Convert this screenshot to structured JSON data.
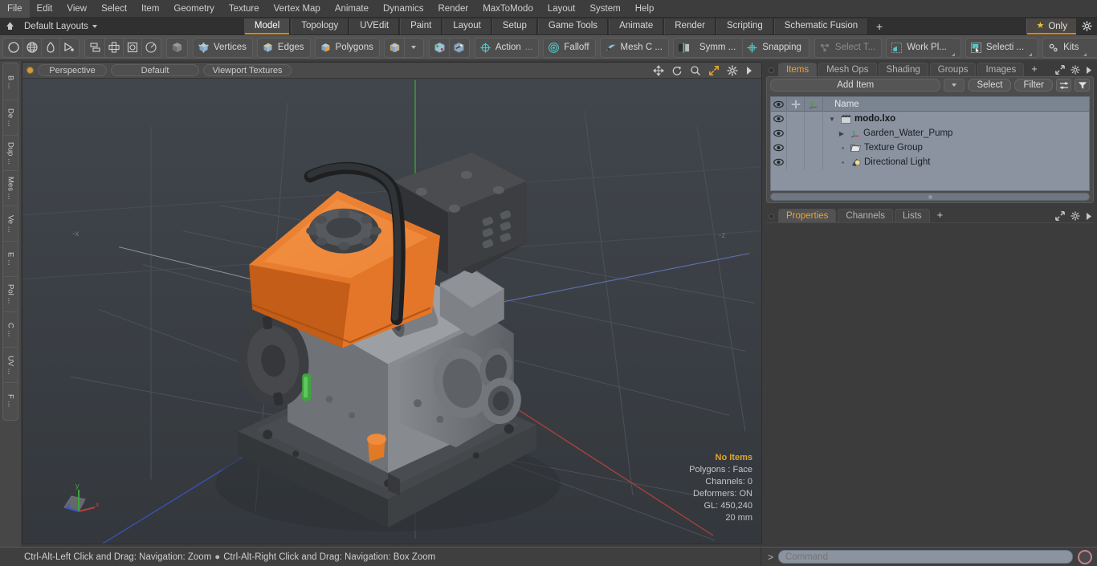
{
  "menu": {
    "items": [
      "File",
      "Edit",
      "View",
      "Select",
      "Item",
      "Geometry",
      "Texture",
      "Vertex Map",
      "Animate",
      "Dynamics",
      "Render",
      "MaxToModo",
      "Layout",
      "System",
      "Help"
    ]
  },
  "layoutbar": {
    "home_icon": "home-icon",
    "layouts_label": "Default Layouts",
    "tabs": [
      {
        "label": "Model",
        "active": true
      },
      {
        "label": "Topology",
        "active": false
      },
      {
        "label": "UVEdit",
        "active": false
      },
      {
        "label": "Paint",
        "active": false
      },
      {
        "label": "Layout",
        "active": false
      },
      {
        "label": "Setup",
        "active": false
      },
      {
        "label": "Game Tools",
        "active": false
      },
      {
        "label": "Animate",
        "active": false
      },
      {
        "label": "Render",
        "active": false
      },
      {
        "label": "Scripting",
        "active": false
      },
      {
        "label": "Schematic Fusion",
        "active": false
      }
    ],
    "add_tab_label": "+",
    "only_label": "Only",
    "gear_icon": "gear-icon",
    "accent_color": "#d08a2a"
  },
  "toolbar": {
    "shape_tools": [
      "circle-icon",
      "globe-icon",
      "pen-icon",
      "curve-icon"
    ],
    "arrange_tools": [
      "duplicate-icon",
      "align-icon",
      "center-icon",
      "radial-icon"
    ],
    "mode_cube_icon": "cube-icon",
    "selection_modes": [
      {
        "label": "Vertices",
        "icon": "vertices-cube-icon"
      },
      {
        "label": "Edges",
        "icon": "edges-cube-icon"
      },
      {
        "label": "Polygons",
        "icon": "polygons-cube-icon"
      }
    ],
    "items_mode_icon": "items-cube-icon",
    "dropdown_icon": "chevron-down-icon",
    "mesh_icons": [
      "mesh-a-icon",
      "mesh-b-icon"
    ],
    "action_label": "Action",
    "action_ellipsis": "...",
    "falloff_label": "Falloff",
    "meshconst_label": "Mesh C ...",
    "symmetry_label": "Symm ...",
    "snapping_label": "Snapping",
    "select_through_label": "Select T...",
    "workplane_label": "Work Pl...",
    "selection_label": "Selecti  ...",
    "kits_label": "Kits",
    "right_icons": [
      "substance-icon",
      "unreal-icon"
    ]
  },
  "left_strip": {
    "tabs": [
      "B ...",
      "De ...",
      "Dup ...",
      "Mes ...",
      "Ve ...",
      "E ...",
      "Pol ...",
      "C ...",
      "UV ...",
      "F ..."
    ]
  },
  "viewport": {
    "indicator_icon": "viewport-active-dot",
    "view_mode": "Perspective",
    "shading_preset": "Default",
    "display_mode": "Viewport Textures",
    "tools": [
      "pan-icon",
      "rotate-icon",
      "zoom-icon",
      "fit-icon",
      "gear-icon",
      "chevron-right-icon"
    ],
    "axis_label_left": "-x",
    "axis_label_right": "-z",
    "stats": {
      "selection": "No Items",
      "polygons": "Polygons : Face",
      "channels": "Channels: 0",
      "deformers": "Deformers: ON",
      "gl": "GL: 450,240",
      "scale": "20 mm"
    },
    "gizmo": {
      "x": "x",
      "y": "y",
      "z": "z"
    },
    "colors": {
      "background": "#3b4045",
      "grid": "#4e545b",
      "axis_x": "#b4423a",
      "axis_y": "#3fa33f",
      "axis_z": "#3b56c4",
      "highlight": "#e0a32e",
      "model_orange": "#e8782a",
      "model_dark": "#3a3c3e",
      "model_grey": "#8b8e91"
    }
  },
  "right_panel": {
    "items_tabs": [
      {
        "label": "Items",
        "active": true
      },
      {
        "label": "Mesh Ops",
        "active": false
      },
      {
        "label": "Shading",
        "active": false
      },
      {
        "label": "Groups",
        "active": false
      },
      {
        "label": "Images",
        "active": false
      }
    ],
    "items_add_tab": "+",
    "panel_icons": [
      "expand-icon",
      "gear-icon",
      "chevron-right-icon"
    ],
    "add_item_label": "Add Item",
    "select_label": "Select",
    "filter_label": "Filter",
    "list_icons": [
      "list-options-icon",
      "funnel-icon"
    ],
    "columns": [
      {
        "name": "visibility-column",
        "icon": "eye-icon"
      },
      {
        "name": "lock-column",
        "icon": "plus-icon"
      },
      {
        "name": "transform-column",
        "icon": "axis-icon"
      },
      {
        "name": "name-column",
        "label": "Name"
      }
    ],
    "rows": [
      {
        "name": "modo.lxo",
        "icon": "scene-icon",
        "depth": 0,
        "expanded": true,
        "bold": true
      },
      {
        "name": "Garden_Water_Pump",
        "icon": "mesh-axis-icon",
        "depth": 1,
        "expanded": false,
        "bold": false
      },
      {
        "name": "Texture Group",
        "icon": "folder-icon",
        "depth": 1,
        "expanded": null,
        "bold": false
      },
      {
        "name": "Directional Light",
        "icon": "light-icon",
        "depth": 1,
        "expanded": null,
        "bold": false
      }
    ],
    "props_tabs": [
      {
        "label": "Properties",
        "active": true
      },
      {
        "label": "Channels",
        "active": false
      },
      {
        "label": "Lists",
        "active": false
      }
    ],
    "props_add_tab": "+"
  },
  "statusbar": {
    "hint_left": "Ctrl-Alt-Left Click and Drag: Navigation: Zoom",
    "hint_bullet": "●",
    "hint_right": "Ctrl-Alt-Right Click and Drag: Navigation: Box Zoom",
    "command_prompt": ">",
    "command_placeholder": "Command",
    "command_value": "",
    "record_icon": "record-circle-icon"
  }
}
